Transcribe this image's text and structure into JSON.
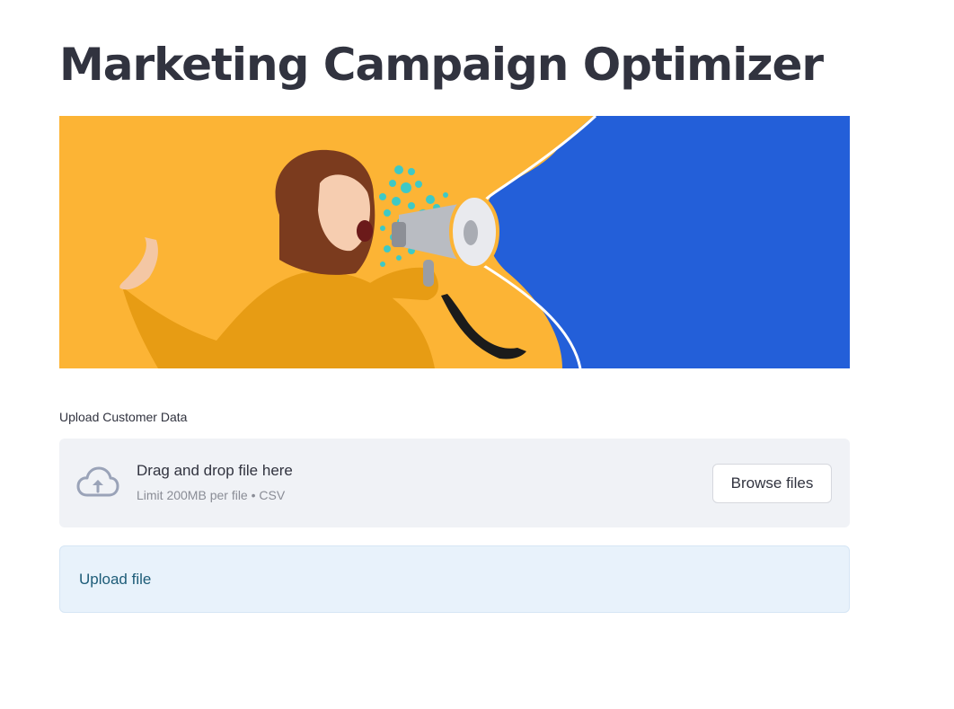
{
  "page": {
    "title": "Marketing Campaign Optimizer"
  },
  "banner": {
    "image": "woman-with-megaphone",
    "colors": {
      "left_bg": "#fcb435",
      "right_bg": "#235fd9",
      "accent": "#3ec9c6"
    }
  },
  "uploader": {
    "label": "Upload Customer Data",
    "drag_text": "Drag and drop file here",
    "limit_text": "Limit 200MB per file • CSV",
    "browse_label": "Browse files",
    "icon": "cloud-upload-icon"
  },
  "info": {
    "message": "Upload file"
  }
}
